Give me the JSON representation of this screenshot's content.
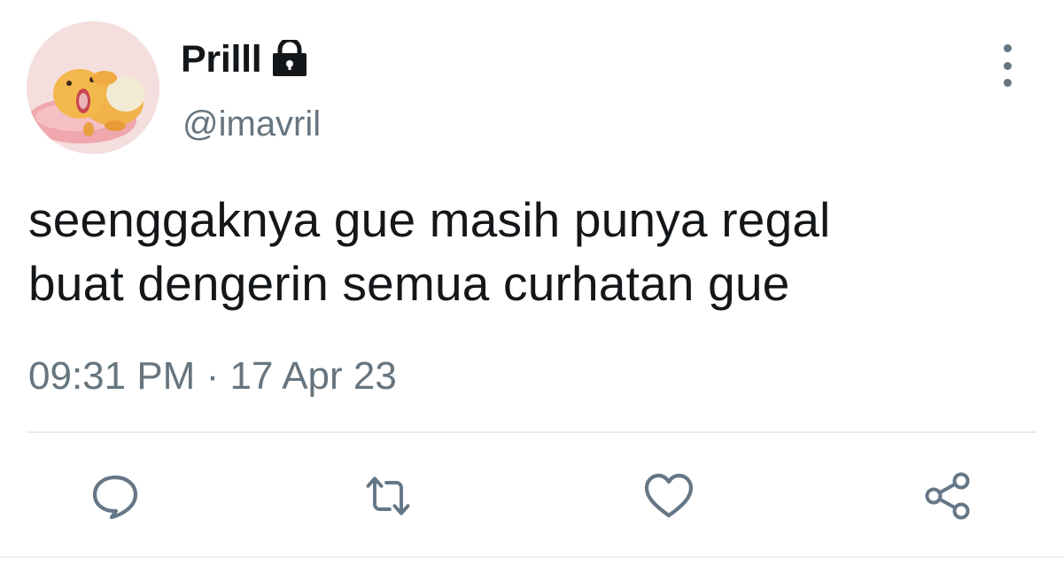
{
  "tweet": {
    "display_name": "Prilll",
    "handle": "@imavril",
    "text_lines": [
      "seenggaknya gue masih punya regal",
      "buat dengerin semua curhatan gue"
    ],
    "time": "09:31 PM",
    "separator": "·",
    "date": "17 Apr 23"
  },
  "icons": {
    "lock": "lock-icon",
    "more": "more-vertical-icon",
    "reply": "reply-icon",
    "retweet": "retweet-icon",
    "like": "heart-icon",
    "share": "share-icon"
  },
  "colors": {
    "text": "#14171a",
    "secondary": "#66757f",
    "divider": "#e6ecf0",
    "action_icon": "#657786"
  }
}
